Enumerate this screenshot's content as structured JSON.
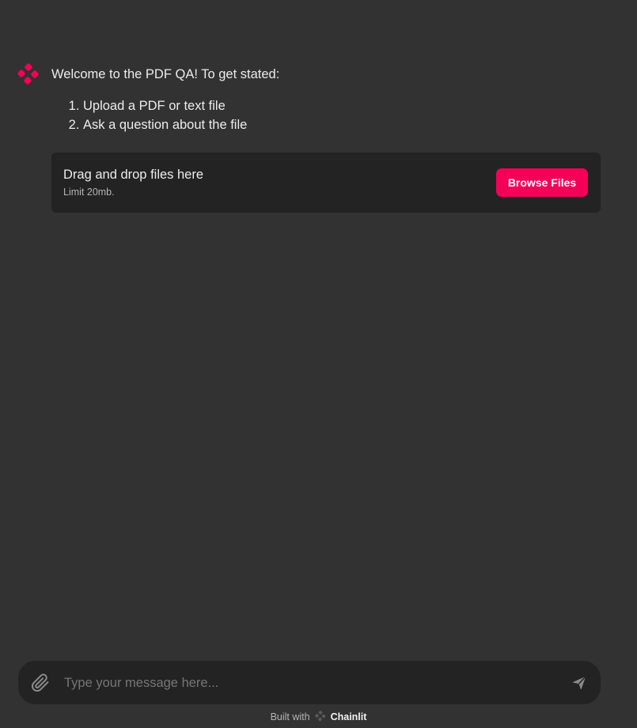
{
  "message": {
    "avatar_icon": "chainlit-logo-icon",
    "accent": "#f50057",
    "title": "Welcome to the PDF QA! To get stated:",
    "steps": [
      "Upload a PDF or text file",
      "Ask a question about the file"
    ]
  },
  "upload": {
    "title": "Drag and drop files here",
    "limit": "Limit 20mb.",
    "browse_label": "Browse Files"
  },
  "composer": {
    "attach_icon": "paperclip-icon",
    "placeholder": "Type your message here...",
    "value": "",
    "send_icon": "send-icon"
  },
  "footer": {
    "prefix": "Built with",
    "brand": "Chainlit"
  }
}
